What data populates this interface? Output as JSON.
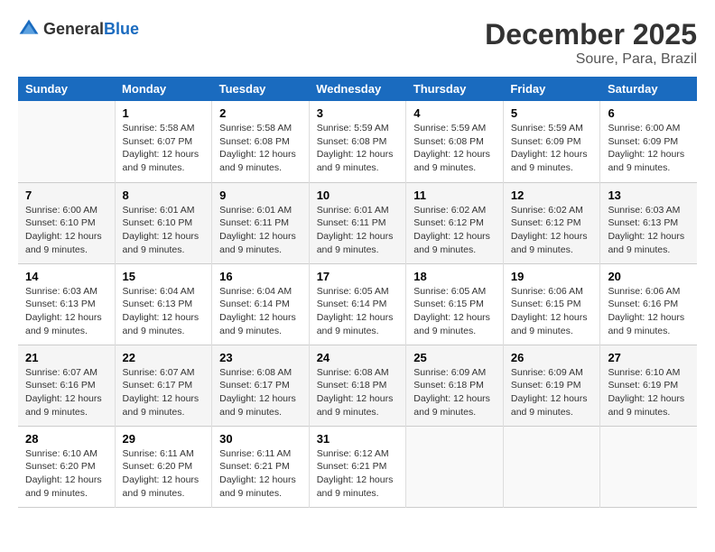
{
  "header": {
    "logo_general": "General",
    "logo_blue": "Blue",
    "month": "December 2025",
    "location": "Soure, Para, Brazil"
  },
  "days_of_week": [
    "Sunday",
    "Monday",
    "Tuesday",
    "Wednesday",
    "Thursday",
    "Friday",
    "Saturday"
  ],
  "weeks": [
    [
      {
        "day": "",
        "info": ""
      },
      {
        "day": "1",
        "info": "Sunrise: 5:58 AM\nSunset: 6:07 PM\nDaylight: 12 hours\nand 9 minutes."
      },
      {
        "day": "2",
        "info": "Sunrise: 5:58 AM\nSunset: 6:08 PM\nDaylight: 12 hours\nand 9 minutes."
      },
      {
        "day": "3",
        "info": "Sunrise: 5:59 AM\nSunset: 6:08 PM\nDaylight: 12 hours\nand 9 minutes."
      },
      {
        "day": "4",
        "info": "Sunrise: 5:59 AM\nSunset: 6:08 PM\nDaylight: 12 hours\nand 9 minutes."
      },
      {
        "day": "5",
        "info": "Sunrise: 5:59 AM\nSunset: 6:09 PM\nDaylight: 12 hours\nand 9 minutes."
      },
      {
        "day": "6",
        "info": "Sunrise: 6:00 AM\nSunset: 6:09 PM\nDaylight: 12 hours\nand 9 minutes."
      }
    ],
    [
      {
        "day": "7",
        "info": "Sunrise: 6:00 AM\nSunset: 6:10 PM\nDaylight: 12 hours\nand 9 minutes."
      },
      {
        "day": "8",
        "info": "Sunrise: 6:01 AM\nSunset: 6:10 PM\nDaylight: 12 hours\nand 9 minutes."
      },
      {
        "day": "9",
        "info": "Sunrise: 6:01 AM\nSunset: 6:11 PM\nDaylight: 12 hours\nand 9 minutes."
      },
      {
        "day": "10",
        "info": "Sunrise: 6:01 AM\nSunset: 6:11 PM\nDaylight: 12 hours\nand 9 minutes."
      },
      {
        "day": "11",
        "info": "Sunrise: 6:02 AM\nSunset: 6:12 PM\nDaylight: 12 hours\nand 9 minutes."
      },
      {
        "day": "12",
        "info": "Sunrise: 6:02 AM\nSunset: 6:12 PM\nDaylight: 12 hours\nand 9 minutes."
      },
      {
        "day": "13",
        "info": "Sunrise: 6:03 AM\nSunset: 6:13 PM\nDaylight: 12 hours\nand 9 minutes."
      }
    ],
    [
      {
        "day": "14",
        "info": "Sunrise: 6:03 AM\nSunset: 6:13 PM\nDaylight: 12 hours\nand 9 minutes."
      },
      {
        "day": "15",
        "info": "Sunrise: 6:04 AM\nSunset: 6:13 PM\nDaylight: 12 hours\nand 9 minutes."
      },
      {
        "day": "16",
        "info": "Sunrise: 6:04 AM\nSunset: 6:14 PM\nDaylight: 12 hours\nand 9 minutes."
      },
      {
        "day": "17",
        "info": "Sunrise: 6:05 AM\nSunset: 6:14 PM\nDaylight: 12 hours\nand 9 minutes."
      },
      {
        "day": "18",
        "info": "Sunrise: 6:05 AM\nSunset: 6:15 PM\nDaylight: 12 hours\nand 9 minutes."
      },
      {
        "day": "19",
        "info": "Sunrise: 6:06 AM\nSunset: 6:15 PM\nDaylight: 12 hours\nand 9 minutes."
      },
      {
        "day": "20",
        "info": "Sunrise: 6:06 AM\nSunset: 6:16 PM\nDaylight: 12 hours\nand 9 minutes."
      }
    ],
    [
      {
        "day": "21",
        "info": "Sunrise: 6:07 AM\nSunset: 6:16 PM\nDaylight: 12 hours\nand 9 minutes."
      },
      {
        "day": "22",
        "info": "Sunrise: 6:07 AM\nSunset: 6:17 PM\nDaylight: 12 hours\nand 9 minutes."
      },
      {
        "day": "23",
        "info": "Sunrise: 6:08 AM\nSunset: 6:17 PM\nDaylight: 12 hours\nand 9 minutes."
      },
      {
        "day": "24",
        "info": "Sunrise: 6:08 AM\nSunset: 6:18 PM\nDaylight: 12 hours\nand 9 minutes."
      },
      {
        "day": "25",
        "info": "Sunrise: 6:09 AM\nSunset: 6:18 PM\nDaylight: 12 hours\nand 9 minutes."
      },
      {
        "day": "26",
        "info": "Sunrise: 6:09 AM\nSunset: 6:19 PM\nDaylight: 12 hours\nand 9 minutes."
      },
      {
        "day": "27",
        "info": "Sunrise: 6:10 AM\nSunset: 6:19 PM\nDaylight: 12 hours\nand 9 minutes."
      }
    ],
    [
      {
        "day": "28",
        "info": "Sunrise: 6:10 AM\nSunset: 6:20 PM\nDaylight: 12 hours\nand 9 minutes."
      },
      {
        "day": "29",
        "info": "Sunrise: 6:11 AM\nSunset: 6:20 PM\nDaylight: 12 hours\nand 9 minutes."
      },
      {
        "day": "30",
        "info": "Sunrise: 6:11 AM\nSunset: 6:21 PM\nDaylight: 12 hours\nand 9 minutes."
      },
      {
        "day": "31",
        "info": "Sunrise: 6:12 AM\nSunset: 6:21 PM\nDaylight: 12 hours\nand 9 minutes."
      },
      {
        "day": "",
        "info": ""
      },
      {
        "day": "",
        "info": ""
      },
      {
        "day": "",
        "info": ""
      }
    ]
  ]
}
